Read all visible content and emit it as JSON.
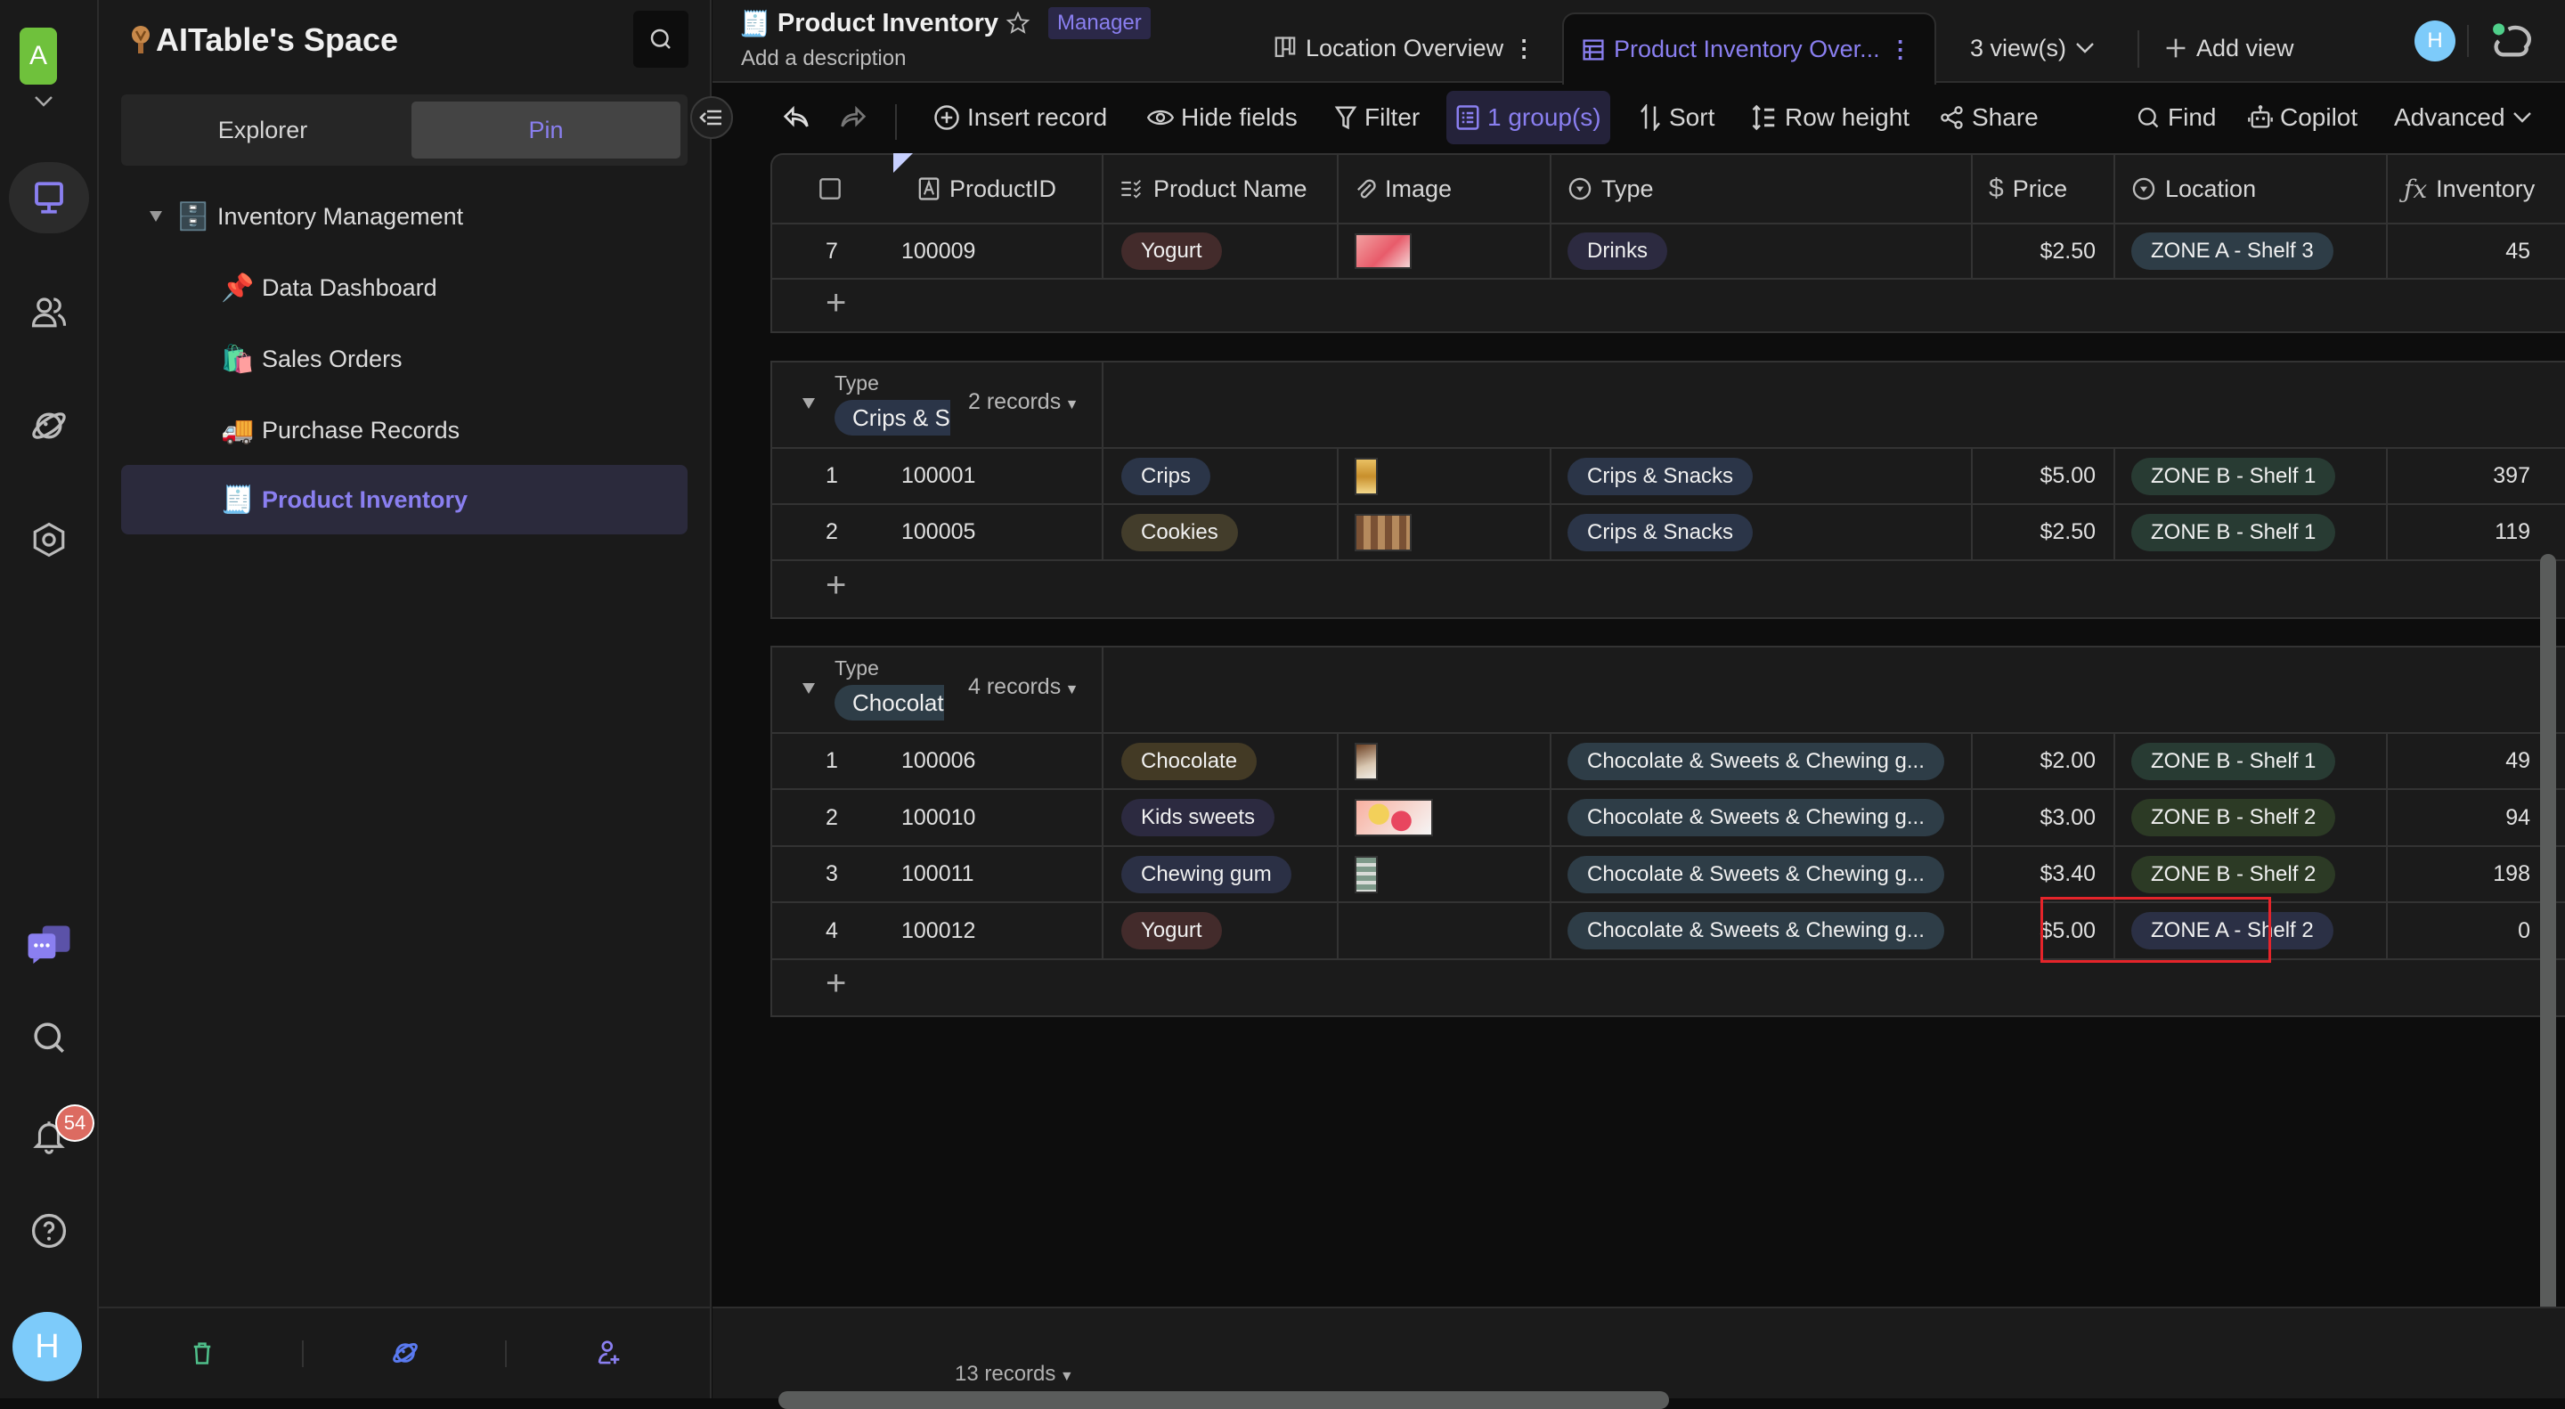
{
  "rail": {
    "space_initial": "A",
    "notification_count": "54",
    "user_initial": "H",
    "icons": [
      "workbench-icon",
      "contacts-icon",
      "explore-icon",
      "settings-icon",
      "chat-icon",
      "search-icon",
      "notification-bell-icon",
      "help-icon"
    ]
  },
  "sidebar": {
    "space_name": "AITable's Space",
    "tabs": [
      {
        "label": "Explorer",
        "selected": false
      },
      {
        "label": "Pin",
        "selected": true
      }
    ],
    "folder": {
      "label": "Inventory Management",
      "emoji": "🗄️",
      "expanded": true
    },
    "items": [
      {
        "label": "Data Dashboard",
        "emoji": "📌",
        "active": false
      },
      {
        "label": "Sales Orders",
        "emoji": "🛍️",
        "active": false
      },
      {
        "label": "Purchase Records",
        "emoji": "🚚",
        "active": false
      },
      {
        "label": "Product Inventory",
        "emoji": "🧾",
        "active": true
      }
    ],
    "footer_icons": [
      "trash-icon",
      "planet-icon",
      "invite-member-icon"
    ]
  },
  "header": {
    "title": "Product Inventory",
    "title_emoji": "🧾",
    "role": "Manager",
    "description_placeholder": "Add a description",
    "views": [
      {
        "label": "Location Overview",
        "icon": "kanban-icon",
        "active": false
      },
      {
        "label": "Product Inventory Over...",
        "icon": "grid-icon",
        "active": true
      }
    ],
    "views_count": "3 view(s)",
    "add_view": "Add view",
    "user_initial": "H"
  },
  "toolbar": {
    "insert_record": "Insert record",
    "hide_fields": "Hide fields",
    "filter": "Filter",
    "group": "1 group(s)",
    "sort": "Sort",
    "row_height": "Row height",
    "share": "Share",
    "find": "Find",
    "copilot": "Copilot",
    "advanced": "Advanced"
  },
  "table": {
    "columns": [
      {
        "label": "ProductID",
        "icon": "text-field-icon"
      },
      {
        "label": "Product Name",
        "icon": "multi-select-icon"
      },
      {
        "label": "Image",
        "icon": "attachment-icon"
      },
      {
        "label": "Type",
        "icon": "single-select-icon"
      },
      {
        "label": "Price",
        "icon": "currency-icon"
      },
      {
        "label": "Location",
        "icon": "single-select-icon"
      },
      {
        "label": "Inventory",
        "icon": "formula-icon"
      }
    ],
    "groups": [
      {
        "field": "Type",
        "value": "Drinks",
        "partial": true,
        "rows": [
          {
            "index": "7",
            "id": "100009",
            "name": "Yogurt",
            "name_color": "#432b2b",
            "image": "yogurt",
            "type": "Drinks",
            "type_color": "#2c2a40",
            "price": "$2.50",
            "location": "ZONE A - Shelf 3",
            "location_color": "#2e3d47",
            "inventory": "45"
          }
        ]
      },
      {
        "field": "Type",
        "value": "Crips & Snacks",
        "value_visible": "Crips & S",
        "count": "2 records",
        "rows": [
          {
            "index": "1",
            "id": "100001",
            "name": "Crips",
            "name_color": "#2b3548",
            "image": "crisps",
            "type": "Crips & Snacks",
            "type_color": "#2b3548",
            "price": "$5.00",
            "location": "ZONE B - Shelf 1",
            "location_color": "#283b33",
            "inventory": "397"
          },
          {
            "index": "2",
            "id": "100005",
            "name": "Cookies",
            "name_color": "#433d2b",
            "image": "cookies",
            "type": "Crips & Snacks",
            "type_color": "#2b3548",
            "price": "$2.50",
            "location": "ZONE B - Shelf 1",
            "location_color": "#283b33",
            "inventory": "119"
          }
        ]
      },
      {
        "field": "Type",
        "value": "Chocolate & Sweets & Chewing gum",
        "value_visible": "Chocolat",
        "count": "4 records",
        "rows": [
          {
            "index": "1",
            "id": "100006",
            "name": "Chocolate",
            "name_color": "#433a25",
            "image": "chocolate",
            "type": "Chocolate & Sweets & Chewing g...",
            "type_color": "#2e3d47",
            "price": "$2.00",
            "location": "ZONE B - Shelf 1",
            "location_color": "#283b33",
            "inventory": "49"
          },
          {
            "index": "2",
            "id": "100010",
            "name": "Kids sweets",
            "name_color": "#2c2a40",
            "image": "sweets",
            "type": "Chocolate & Sweets & Chewing g...",
            "type_color": "#2e3d47",
            "price": "$3.00",
            "location": "ZONE B - Shelf 2",
            "location_color": "#2c3a25",
            "inventory": "94"
          },
          {
            "index": "3",
            "id": "100011",
            "name": "Chewing gum",
            "name_color": "#2b3045",
            "image": "gum",
            "type": "Chocolate & Sweets & Chewing g...",
            "type_color": "#2e3d47",
            "price": "$3.40",
            "location": "ZONE B - Shelf 2",
            "location_color": "#2c3a25",
            "inventory": "198"
          },
          {
            "index": "4",
            "id": "100012",
            "name": "Yogurt",
            "name_color": "#432b2b",
            "image": "",
            "type": "Chocolate & Sweets & Chewing g...",
            "type_color": "#2e3d47",
            "price": "$5.00",
            "location": "ZONE A - Shelf 2",
            "location_color": "#2b3045",
            "inventory": "0",
            "selected_cell": "Image"
          }
        ]
      }
    ],
    "total_records": "13 records"
  },
  "colors": {
    "accent": "#8a7ff0",
    "selection": "#e5242a",
    "space_avatar": "#6fc13c",
    "user_avatar": "#7dcbfa",
    "badge": "#dc6b61"
  }
}
